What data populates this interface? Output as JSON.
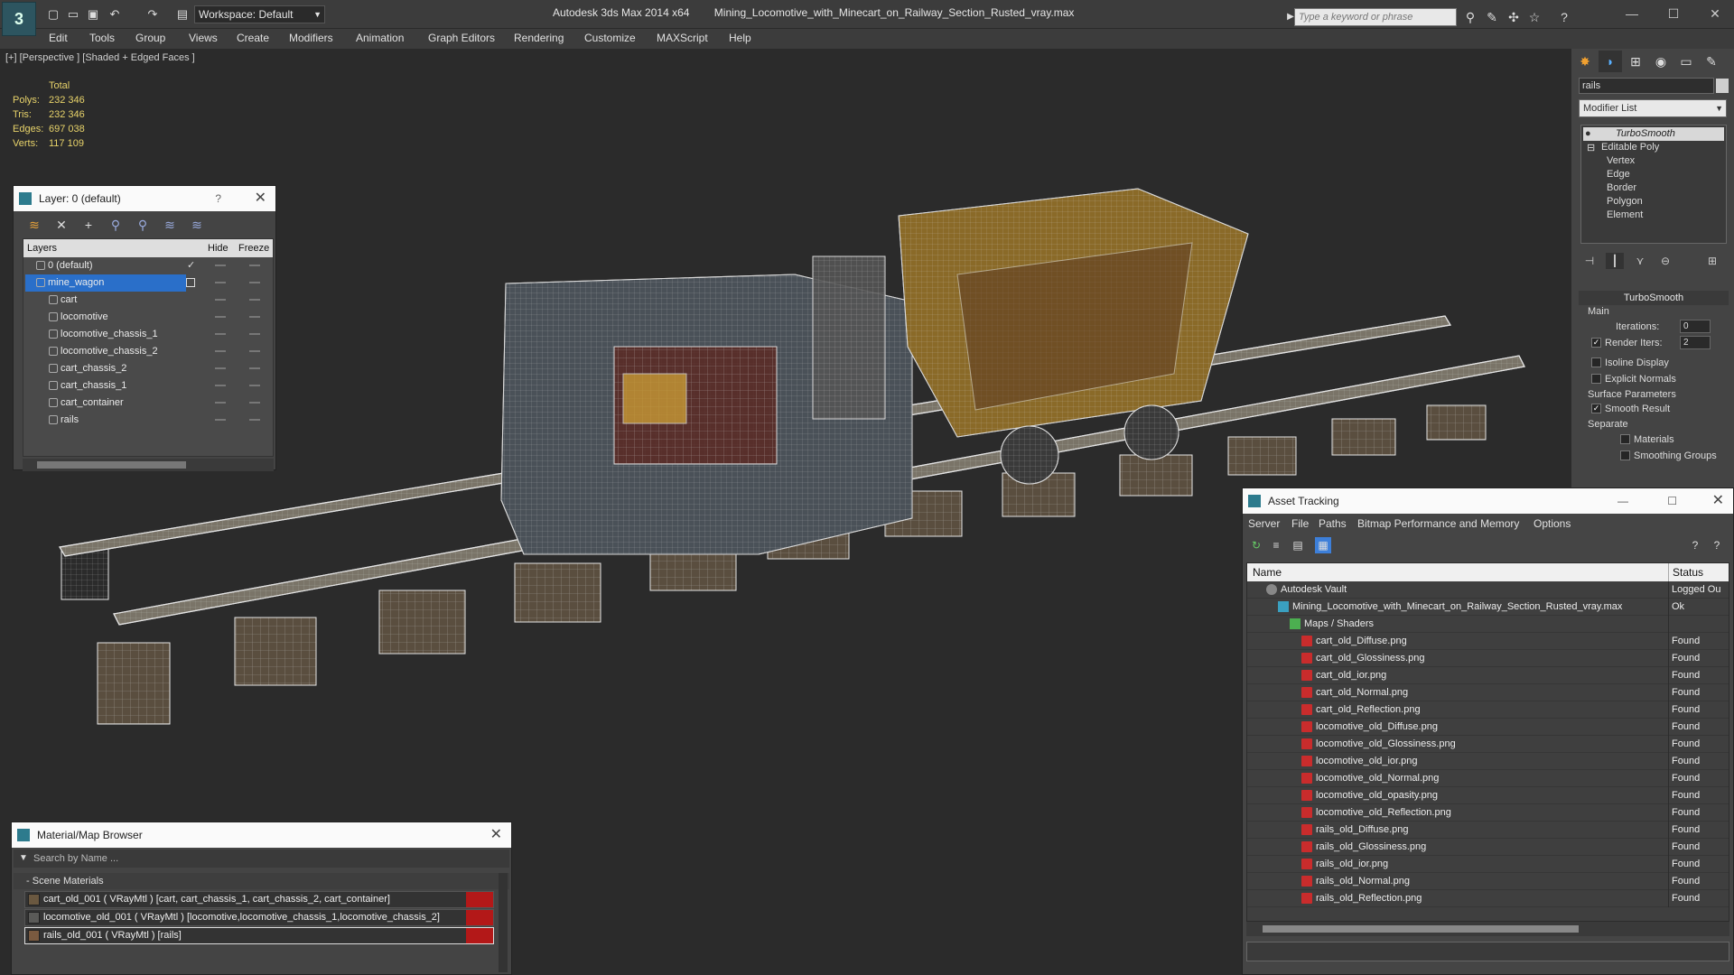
{
  "app": {
    "title": "Autodesk 3ds Max  2014 x64",
    "file": "Mining_Locomotive_with_Minecart_on_Railway_Section_Rusted_vray.max",
    "logo_text": "3",
    "workspace": "Workspace: Default",
    "search_placeholder": "Type a keyword or phrase"
  },
  "menu": [
    "Edit",
    "Tools",
    "Group",
    "Views",
    "Create",
    "Modifiers",
    "Animation",
    "Graph Editors",
    "Rendering",
    "Customize",
    "MAXScript",
    "Help"
  ],
  "viewport": {
    "label": "[+] [Perspective ] [Shaded + Edged Faces ]",
    "stats": {
      "header": "Total",
      "rows": [
        {
          "label": "Polys:",
          "value": "232 346"
        },
        {
          "label": "Tris:",
          "value": "232 346"
        },
        {
          "label": "Edges:",
          "value": "697 038"
        },
        {
          "label": "Verts:",
          "value": "117 109"
        }
      ]
    }
  },
  "layer_explorer": {
    "title": "Layer: 0 (default)",
    "help": "?",
    "columns": {
      "layers": "Layers",
      "hide": "Hide",
      "freeze": "Freeze"
    },
    "rows": [
      {
        "name": "0 (default)",
        "level": 0,
        "active": true
      },
      {
        "name": "mine_wagon",
        "level": 0,
        "selected": true
      },
      {
        "name": "cart",
        "level": 1
      },
      {
        "name": "locomotive",
        "level": 1
      },
      {
        "name": "locomotive_chassis_1",
        "level": 1
      },
      {
        "name": "locomotive_chassis_2",
        "level": 1
      },
      {
        "name": "cart_chassis_2",
        "level": 1
      },
      {
        "name": "cart_chassis_1",
        "level": 1
      },
      {
        "name": "cart_container",
        "level": 1
      },
      {
        "name": "rails",
        "level": 1
      }
    ]
  },
  "material_browser": {
    "title": "Material/Map Browser",
    "search_placeholder": "Search by Name ...",
    "section": "Scene Materials",
    "materials": [
      "cart_old_001  ( VRayMtl )  [cart, cart_chassis_1, cart_chassis_2, cart_container]",
      "locomotive_old_001 ( VRayMtl ) [locomotive,locomotive_chassis_1,locomotive_chassis_2]",
      "rails_old_001  ( VRayMtl )  [rails]"
    ]
  },
  "command_panel": {
    "object_name": "rails",
    "modifier_list": "Modifier List",
    "stack": {
      "top": "TurboSmooth",
      "base": "Editable Poly",
      "sub": [
        "Vertex",
        "Edge",
        "Border",
        "Polygon",
        "Element"
      ]
    },
    "rollout": {
      "title": "TurboSmooth",
      "main": "Main",
      "iterations_label": "Iterations:",
      "iterations": "0",
      "render_iters_label": "Render Iters:",
      "render_iters": "2",
      "isoline": "Isoline Display",
      "explicit": "Explicit Normals",
      "surface_params": "Surface Parameters",
      "smooth_result": "Smooth Result",
      "separate": "Separate",
      "materials": "Materials",
      "smoothing_groups": "Smoothing Groups"
    }
  },
  "asset_tracking": {
    "title": "Asset Tracking",
    "menu": [
      "Server",
      "File",
      "Paths",
      "Bitmap Performance and Memory",
      "Options"
    ],
    "columns": {
      "name": "Name",
      "status": "Status"
    },
    "rows": [
      {
        "name": "Autodesk Vault",
        "status": "Logged Ou",
        "indent": 1,
        "icon": "vault"
      },
      {
        "name": "Mining_Locomotive_with_Minecart_on_Railway_Section_Rusted_vray.max",
        "status": "Ok",
        "indent": 2,
        "icon": "max"
      },
      {
        "name": "Maps / Shaders",
        "status": "",
        "indent": 3,
        "icon": "map"
      },
      {
        "name": "cart_old_Diffuse.png",
        "status": "Found",
        "indent": 4,
        "icon": "png"
      },
      {
        "name": "cart_old_Glossiness.png",
        "status": "Found",
        "indent": 4,
        "icon": "png"
      },
      {
        "name": "cart_old_ior.png",
        "status": "Found",
        "indent": 4,
        "icon": "png"
      },
      {
        "name": "cart_old_Normal.png",
        "status": "Found",
        "indent": 4,
        "icon": "png"
      },
      {
        "name": "cart_old_Reflection.png",
        "status": "Found",
        "indent": 4,
        "icon": "png"
      },
      {
        "name": "locomotive_old_Diffuse.png",
        "status": "Found",
        "indent": 4,
        "icon": "png"
      },
      {
        "name": "locomotive_old_Glossiness.png",
        "status": "Found",
        "indent": 4,
        "icon": "png"
      },
      {
        "name": "locomotive_old_ior.png",
        "status": "Found",
        "indent": 4,
        "icon": "png"
      },
      {
        "name": "locomotive_old_Normal.png",
        "status": "Found",
        "indent": 4,
        "icon": "png"
      },
      {
        "name": "locomotive_old_opasity.png",
        "status": "Found",
        "indent": 4,
        "icon": "png"
      },
      {
        "name": "locomotive_old_Reflection.png",
        "status": "Found",
        "indent": 4,
        "icon": "png"
      },
      {
        "name": "rails_old_Diffuse.png",
        "status": "Found",
        "indent": 4,
        "icon": "png"
      },
      {
        "name": "rails_old_Glossiness.png",
        "status": "Found",
        "indent": 4,
        "icon": "png"
      },
      {
        "name": "rails_old_ior.png",
        "status": "Found",
        "indent": 4,
        "icon": "png"
      },
      {
        "name": "rails_old_Normal.png",
        "status": "Found",
        "indent": 4,
        "icon": "png"
      },
      {
        "name": "rails_old_Reflection.png",
        "status": "Found",
        "indent": 4,
        "icon": "png"
      }
    ]
  },
  "colors": {
    "selection": "#2a6fc9",
    "stats_text": "#e8d36a",
    "material_flag": "#b31818"
  }
}
